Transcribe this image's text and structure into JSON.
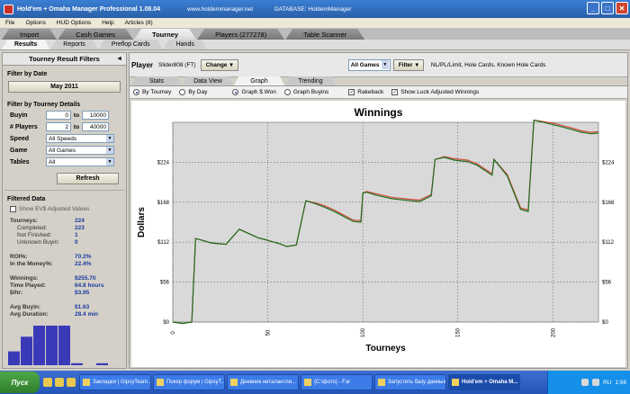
{
  "window": {
    "title": "Hold'em + Omaha Manager Professional 1.08.04",
    "url": "www.holdemmanager.net",
    "database": "DATABASE: HoldemManager"
  },
  "menu": [
    "File",
    "Options",
    "HUD Options",
    "Help",
    "Articles (8)"
  ],
  "main_tabs": [
    {
      "label": "Import"
    },
    {
      "label": "Cash Games"
    },
    {
      "label": "Tourney",
      "active": true
    },
    {
      "label": "Players (277278)"
    },
    {
      "label": "Table Scanner"
    }
  ],
  "sub_tabs": [
    {
      "label": "Results",
      "active": true
    },
    {
      "label": "Reports"
    },
    {
      "label": "Preflop Cards"
    },
    {
      "label": "Hands"
    }
  ],
  "left": {
    "header": "Tourney Result Filters",
    "collapse_icon": "◄",
    "date_title": "Filter by Date",
    "date_button": "May 2011",
    "details_title": "Filter by Tourney Details",
    "buyin": {
      "label": "Buyin",
      "from": "0",
      "to_label": "to",
      "to": "10000"
    },
    "players": {
      "label": "# Players",
      "from": "2",
      "to_label": "to",
      "to": "40000"
    },
    "speed": {
      "label": "Speed",
      "value": "All Speeds"
    },
    "game": {
      "label": "Game",
      "value": "All Games"
    },
    "tables": {
      "label": "Tables",
      "value": "All"
    },
    "refresh": "Refresh",
    "filtered_title": "Filtered Data",
    "show_ev": "Show EV$ Adjusted Values",
    "stats": [
      {
        "k": "Tourneys:",
        "v": "224",
        "sub": false
      },
      {
        "k": "Completed:",
        "v": "223",
        "sub": true
      },
      {
        "k": "Not Finished:",
        "v": "1",
        "sub": true
      },
      {
        "k": "Unknown Buyin:",
        "v": "0",
        "sub": true
      },
      {
        "k": "",
        "v": "",
        "sub": false
      },
      {
        "k": "ROI%:",
        "v": "70.2%",
        "sub": false
      },
      {
        "k": "In the Money%:",
        "v": "22.4%",
        "sub": false
      },
      {
        "k": "",
        "v": "",
        "sub": false
      },
      {
        "k": "Winnings:",
        "v": "$255.70",
        "sub": false
      },
      {
        "k": "Time Played:",
        "v": "64.8 hours",
        "sub": false
      },
      {
        "k": "$/hr:",
        "v": "$3.95",
        "sub": false
      },
      {
        "k": "",
        "v": "",
        "sub": false
      },
      {
        "k": "Avg Buyin:",
        "v": "$1.63",
        "sub": false
      },
      {
        "k": "Avg Duration:",
        "v": "28.4 min",
        "sub": false
      }
    ],
    "histogram": [
      0.35,
      0.72,
      1.0,
      1.0,
      1.0,
      0.05,
      0.0,
      0.05,
      0.0
    ]
  },
  "right": {
    "player_label": "Player",
    "player_name": "Slider808 (FT)",
    "change_btn": "Change",
    "games_select": "All Games",
    "filter_btn": "Filter",
    "filter_desc": "NL/PL/Limit, Hole Cards, Known Hole Cards",
    "view_tabs": [
      {
        "label": "Stats"
      },
      {
        "label": "Data View"
      },
      {
        "label": "Graph",
        "active": true
      },
      {
        "label": "Trending"
      }
    ],
    "options": {
      "by_tourney": "By Tourney",
      "by_day": "By Day",
      "graph_won": "Graph $ Won",
      "graph_buyins": "Graph Buyins",
      "rakeback": "Rakeback",
      "show_luck": "Show Luck Adjusted Winnings"
    }
  },
  "chart_data": {
    "type": "line",
    "title": "Winnings",
    "xlabel": "Tourneys",
    "ylabel": "Dollars",
    "xlim": [
      0,
      224
    ],
    "ylim": [
      0,
      280
    ],
    "yticks": [
      0,
      56,
      112,
      168,
      224
    ],
    "ytick_labels": [
      "$0",
      "$56",
      "$112",
      "$168",
      "$224"
    ],
    "xticks": [
      0,
      50,
      100,
      150,
      200
    ],
    "grid": true,
    "series": [
      {
        "name": "winnings",
        "color": "#1f6e1f",
        "x": [
          0,
          5,
          10,
          12,
          15,
          20,
          28,
          35,
          40,
          45,
          48,
          52,
          56,
          60,
          65,
          70,
          75,
          80,
          85,
          90,
          95,
          99,
          100,
          102,
          107,
          115,
          125,
          130,
          136,
          138,
          143,
          148,
          155,
          160,
          168,
          169,
          176,
          183,
          187,
          190,
          200,
          210,
          215,
          220,
          224
        ],
        "y": [
          0,
          -2,
          0,
          117,
          115,
          111,
          109,
          130,
          124,
          118,
          116,
          113,
          110,
          106,
          108,
          170,
          166,
          161,
          155,
          148,
          141,
          140,
          181,
          182,
          178,
          173,
          170,
          169,
          177,
          228,
          231,
          227,
          225,
          220,
          206,
          228,
          205,
          158,
          155,
          283,
          277,
          270,
          266,
          264,
          265
        ]
      },
      {
        "name": "luck adjusted",
        "color": "#d24a3a",
        "x": [
          0,
          5,
          10,
          12,
          15,
          20,
          28,
          35,
          40,
          45,
          48,
          52,
          56,
          60,
          65,
          70,
          75,
          80,
          85,
          90,
          95,
          99,
          100,
          102,
          107,
          115,
          125,
          130,
          136,
          138,
          143,
          148,
          155,
          160,
          168,
          169,
          176,
          183,
          187,
          190,
          200,
          210,
          215,
          220,
          224
        ],
        "y": [
          0,
          -2,
          0,
          117,
          115,
          111,
          109,
          130,
          124,
          118,
          116,
          113,
          110,
          106,
          108,
          170,
          167,
          163,
          157,
          150,
          143,
          142,
          181,
          183,
          180,
          175,
          172,
          171,
          179,
          228,
          232,
          229,
          227,
          222,
          208,
          228,
          207,
          160,
          157,
          283,
          279,
          272,
          268,
          266,
          267
        ]
      }
    ]
  },
  "taskbar": {
    "start": "Пуск",
    "tasks": [
      {
        "label": "Закладки | GipsyTeam..."
      },
      {
        "label": "Покер форум | GipsyT..."
      },
      {
        "label": "Дневник неталантли..."
      },
      {
        "label": "{C:\\фото} - Far"
      },
      {
        "label": "Запустить базу данных"
      },
      {
        "label": "Hold'em + Omaha M...",
        "active": true
      }
    ],
    "lang": "RU",
    "clock": "1:56"
  }
}
